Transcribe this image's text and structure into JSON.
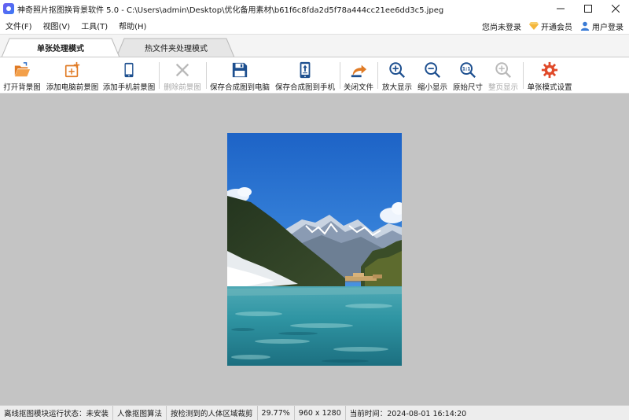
{
  "window": {
    "title": "神奇照片抠图换背景软件 5.0 - C:\\Users\\admin\\Desktop\\优化备用素材\\b61f6c8fda2d5f78a444cc21ee6dd3c5.jpeg"
  },
  "menu": {
    "items": [
      {
        "label": "文件(F)"
      },
      {
        "label": "视图(V)"
      },
      {
        "label": "工具(T)"
      },
      {
        "label": "帮助(H)"
      }
    ],
    "login_status": "您尚未登录",
    "vip": "开通会员",
    "user_login": "用户登录"
  },
  "tabs": {
    "single": "单张处理模式",
    "hot_folder": "热文件夹处理模式"
  },
  "toolbar": {
    "open_bg": "打开背景图",
    "add_pc_fg": "添加电脑前景图",
    "add_phone_fg": "添加手机前景图",
    "delete_fg": "删除前景图",
    "save_pc": "保存合成图到电脑",
    "save_phone": "保存合成图到手机",
    "close_file": "关闭文件",
    "zoom_in": "放大显示",
    "zoom_out": "缩小显示",
    "original_size": "原始尺寸",
    "fit_page": "整页显示",
    "single_settings": "单张模式设置"
  },
  "colors": {
    "accent": "#3a7bd5",
    "folder": "#f0953c",
    "save_blue": "#1d4f8f",
    "canvas_bg": "#c4c4c4",
    "disabled": "#b9b9b9"
  },
  "status": {
    "offline_module": "离线抠图模块运行状态：未安装",
    "algorithm": "人像抠图算法",
    "crop_mode": "按检测到的人体区域裁剪",
    "zoom": "29.77%",
    "dimensions": "960 x 1280",
    "time": "当前时间：2024-08-01 16:14:20"
  }
}
